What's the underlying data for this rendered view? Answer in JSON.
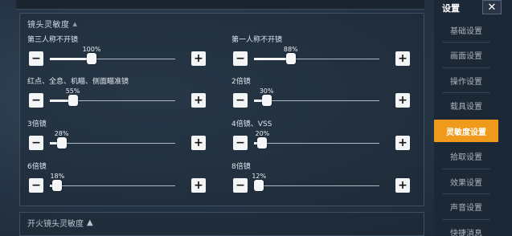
{
  "top_panel": {
    "title": "镜头灵敏度"
  },
  "settings": [
    {
      "label": "第三人称不开镜",
      "value": "100%",
      "level": 100,
      "min_pct": 0,
      "max_pct": 300
    },
    {
      "label": "第一人称不开镜",
      "value": "88%",
      "level": 88,
      "min_pct": 0,
      "max_pct": 300
    },
    {
      "label": "红点、全息、机瞄、侧面瞄准镜",
      "value": "55%",
      "level": 55,
      "min_pct": 0,
      "max_pct": 300
    },
    {
      "label": "2倍镜",
      "value": "30%",
      "level": 30,
      "min_pct": 0,
      "max_pct": 300
    },
    {
      "label": "3倍镜",
      "value": "28%",
      "level": 28,
      "min_pct": 0,
      "max_pct": 300
    },
    {
      "label": "4倍镜、VSS",
      "value": "20%",
      "level": 20,
      "min_pct": 0,
      "max_pct": 300
    },
    {
      "label": "6倍镜",
      "value": "18%",
      "level": 18,
      "min_pct": 0,
      "max_pct": 300
    },
    {
      "label": "8倍镜",
      "value": "12%",
      "level": 12,
      "min_pct": 0,
      "max_pct": 300
    }
  ],
  "buttons": {
    "minus": "−",
    "plus": "+"
  },
  "bottom_panel": {
    "title": "开火镜头灵敏度"
  },
  "sidebar": {
    "title": "设置",
    "close": "✕",
    "items": [
      {
        "label": "基础设置",
        "active": false
      },
      {
        "label": "画面设置",
        "active": false
      },
      {
        "label": "操作设置",
        "active": false
      },
      {
        "label": "载具设置",
        "active": false
      },
      {
        "label": "灵敏度设置",
        "active": true
      },
      {
        "label": "拾取设置",
        "active": false
      },
      {
        "label": "效果设置",
        "active": false
      },
      {
        "label": "声音设置",
        "active": false
      },
      {
        "label": "快捷消息",
        "active": false
      }
    ]
  },
  "colors": {
    "accent": "#f09a1c",
    "background": "#243040",
    "button": "#f2f4f6"
  }
}
